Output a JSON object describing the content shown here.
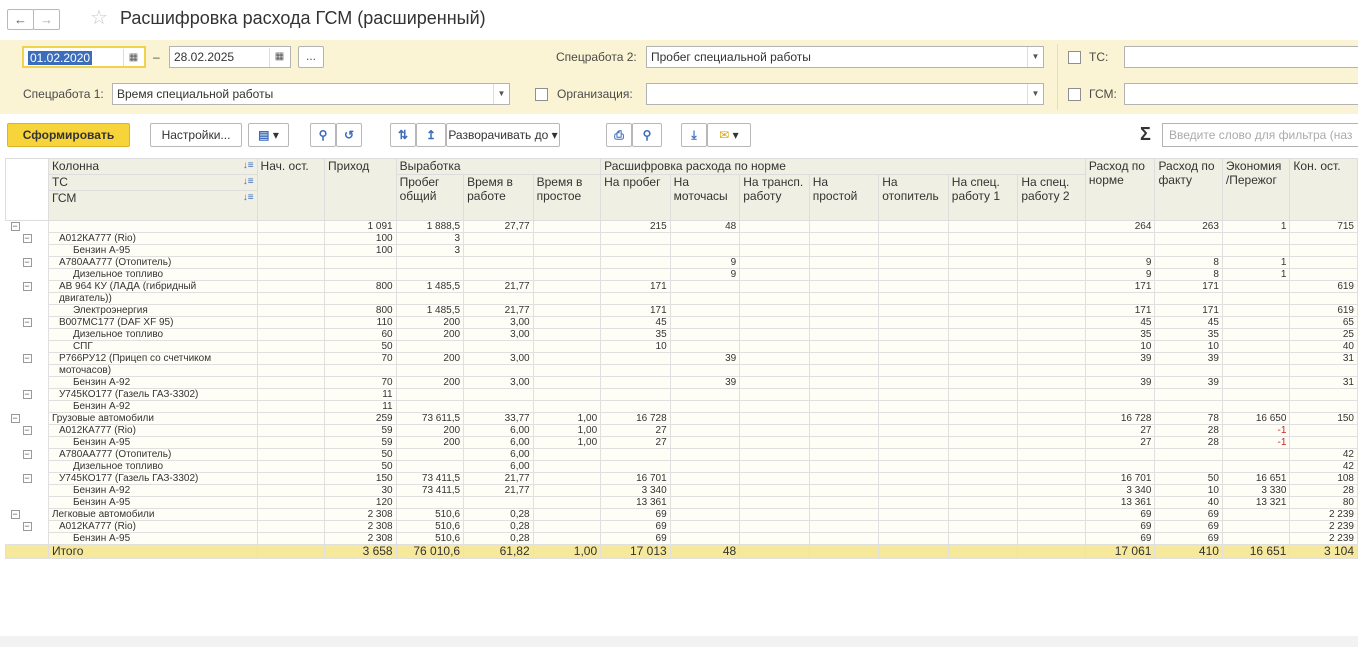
{
  "title": "Расшифровка расхода ГСМ (расширенный)",
  "filters": {
    "date_from": "01.02.2020",
    "date_separator": "–",
    "date_to": "28.02.2025",
    "ellipsis": "...",
    "spec2_label": "Спецработа 2:",
    "spec2_value": "Пробег специальной работы",
    "spec1_label": "Спецработа 1:",
    "spec1_value": "Время специальной работы",
    "org_label": "Организация:",
    "org_value": "",
    "tc_label": "ТС:",
    "gsm_label": "ГСМ:"
  },
  "toolbar": {
    "generate": "Сформировать",
    "settings": "Настройки...",
    "expand": "Разворачивать до",
    "search_placeholder": "Введите слово для фильтра (наз"
  },
  "table": {
    "headers": {
      "column": "Колонна",
      "tc": "ТС",
      "gsm": "ГСМ",
      "start": "Нач. ост.",
      "income": "Приход",
      "output": "Выработка",
      "mileage": "Пробег общий",
      "work_time": "Время в работе",
      "idle_time": "Время в простое",
      "decode": "Расшифровка расхода по норме",
      "n_mileage": "На пробег",
      "n_motohours": "На моточасы",
      "n_transp": "На трансп. работу",
      "n_idle": "На простой",
      "n_heater": "На отопитель",
      "n_spec1": "На спец. работу 1",
      "n_spec2": "На спец. работу 2",
      "norm": "Расход по норме",
      "fact": "Расход по факту",
      "econ": "Экономия /Пережог",
      "end": "Кон. ост."
    },
    "rows": [
      {
        "lvl": 0,
        "tog": "⊟",
        "tname": "",
        "name": "",
        "start": "",
        "income": "1 091",
        "mileage": "1 888,5",
        "work": "27,77",
        "idle": "",
        "nm": "215",
        "nmh": "48",
        "nt": "",
        "ni": "",
        "nh": "",
        "ns1": "",
        "ns2": "",
        "norm": "264",
        "fact": "263",
        "econ": "1",
        "end": "715"
      },
      {
        "lvl": 1,
        "tog": "⊟",
        "name": "А012КА777 (Rio)",
        "start": "",
        "income": "100",
        "mileage": "3",
        "work": "",
        "idle": "",
        "nm": "",
        "nmh": "",
        "nt": "",
        "ni": "",
        "nh": "",
        "ns1": "",
        "ns2": "",
        "norm": "",
        "fact": "",
        "econ": "",
        "end": ""
      },
      {
        "lvl": 2,
        "tog": "",
        "name": "Бензин А-95",
        "start": "",
        "income": "100",
        "mileage": "3",
        "work": "",
        "idle": "",
        "nm": "",
        "nmh": "",
        "nt": "",
        "ni": "",
        "nh": "",
        "ns1": "",
        "ns2": "",
        "norm": "",
        "fact": "",
        "econ": "",
        "end": ""
      },
      {
        "lvl": 1,
        "tog": "⊟",
        "name": "А780АА777 (Отопитель)",
        "start": "",
        "income": "",
        "mileage": "",
        "work": "",
        "idle": "",
        "nm": "",
        "nmh": "9",
        "nt": "",
        "ni": "",
        "nh": "",
        "ns1": "",
        "ns2": "",
        "norm": "9",
        "fact": "8",
        "econ": "1",
        "end": ""
      },
      {
        "lvl": 2,
        "tog": "",
        "name": "Дизельное топливо",
        "start": "",
        "income": "",
        "mileage": "",
        "work": "",
        "idle": "",
        "nm": "",
        "nmh": "9",
        "nt": "",
        "ni": "",
        "nh": "",
        "ns1": "",
        "ns2": "",
        "norm": "9",
        "fact": "8",
        "econ": "1",
        "end": ""
      },
      {
        "lvl": 1,
        "tog": "⊟",
        "name": "АВ 964 КУ (ЛАДА (гибридный",
        "name2": "двигатель))",
        "start": "",
        "income": "800",
        "mileage": "1 485,5",
        "work": "21,77",
        "idle": "",
        "nm": "171",
        "nmh": "",
        "nt": "",
        "ni": "",
        "nh": "",
        "ns1": "",
        "ns2": "",
        "norm": "171",
        "fact": "171",
        "econ": "",
        "end": "619"
      },
      {
        "lvl": 2,
        "tog": "",
        "name": "Электроэнергия",
        "start": "",
        "income": "800",
        "mileage": "1 485,5",
        "work": "21,77",
        "idle": "",
        "nm": "171",
        "nmh": "",
        "nt": "",
        "ni": "",
        "nh": "",
        "ns1": "",
        "ns2": "",
        "norm": "171",
        "fact": "171",
        "econ": "",
        "end": "619"
      },
      {
        "lvl": 1,
        "tog": "⊟",
        "name": "В007МС177 (DAF XF 95)",
        "start": "",
        "income": "110",
        "mileage": "200",
        "work": "3,00",
        "idle": "",
        "nm": "45",
        "nmh": "",
        "nt": "",
        "ni": "",
        "nh": "",
        "ns1": "",
        "ns2": "",
        "norm": "45",
        "fact": "45",
        "econ": "",
        "end": "65"
      },
      {
        "lvl": 2,
        "tog": "",
        "name": "Дизельное топливо",
        "start": "",
        "income": "60",
        "mileage": "200",
        "work": "3,00",
        "idle": "",
        "nm": "35",
        "nmh": "",
        "nt": "",
        "ni": "",
        "nh": "",
        "ns1": "",
        "ns2": "",
        "norm": "35",
        "fact": "35",
        "econ": "",
        "end": "25"
      },
      {
        "lvl": 2,
        "tog": "",
        "name": "СПГ",
        "start": "",
        "income": "50",
        "mileage": "",
        "work": "",
        "idle": "",
        "nm": "10",
        "nmh": "",
        "nt": "",
        "ni": "",
        "nh": "",
        "ns1": "",
        "ns2": "",
        "norm": "10",
        "fact": "10",
        "econ": "",
        "end": "40"
      },
      {
        "lvl": 1,
        "tog": "⊟",
        "name": "Р766РУ12 (Прицеп со счетчиком",
        "name2": "моточасов)",
        "start": "",
        "income": "70",
        "mileage": "200",
        "work": "3,00",
        "idle": "",
        "nm": "",
        "nmh": "39",
        "nt": "",
        "ni": "",
        "nh": "",
        "ns1": "",
        "ns2": "",
        "norm": "39",
        "fact": "39",
        "econ": "",
        "end": "31"
      },
      {
        "lvl": 2,
        "tog": "",
        "name": "Бензин А-92",
        "start": "",
        "income": "70",
        "mileage": "200",
        "work": "3,00",
        "idle": "",
        "nm": "",
        "nmh": "39",
        "nt": "",
        "ni": "",
        "nh": "",
        "ns1": "",
        "ns2": "",
        "norm": "39",
        "fact": "39",
        "econ": "",
        "end": "31"
      },
      {
        "lvl": 1,
        "tog": "⊟",
        "name": "У745КО177 (Газель ГАЗ-3302)",
        "start": "",
        "income": "11",
        "mileage": "",
        "work": "",
        "idle": "",
        "nm": "",
        "nmh": "",
        "nt": "",
        "ni": "",
        "nh": "",
        "ns1": "",
        "ns2": "",
        "norm": "",
        "fact": "",
        "econ": "",
        "end": ""
      },
      {
        "lvl": 2,
        "tog": "",
        "name": "Бензин А-92",
        "start": "",
        "income": "11",
        "mileage": "",
        "work": "",
        "idle": "",
        "nm": "",
        "nmh": "",
        "nt": "",
        "ni": "",
        "nh": "",
        "ns1": "",
        "ns2": "",
        "norm": "",
        "fact": "",
        "econ": "",
        "end": ""
      },
      {
        "lvl": 0,
        "tog": "⊟",
        "name": "Грузовые автомобили",
        "start": "",
        "income": "259",
        "mileage": "73 611,5",
        "work": "33,77",
        "idle": "1,00",
        "nm": "16 728",
        "nmh": "",
        "nt": "",
        "ni": "",
        "nh": "",
        "ns1": "",
        "ns2": "",
        "norm": "16 728",
        "fact": "78",
        "econ": "16 650",
        "end": "150"
      },
      {
        "lvl": 1,
        "tog": "⊟",
        "name": "А012КА777 (Rio)",
        "start": "",
        "income": "59",
        "mileage": "200",
        "work": "6,00",
        "idle": "1,00",
        "nm": "27",
        "nmh": "",
        "nt": "",
        "ni": "",
        "nh": "",
        "ns1": "",
        "ns2": "",
        "norm": "27",
        "fact": "28",
        "econ": "-1",
        "end": ""
      },
      {
        "lvl": 2,
        "tog": "",
        "name": "Бензин А-95",
        "start": "",
        "income": "59",
        "mileage": "200",
        "work": "6,00",
        "idle": "1,00",
        "nm": "27",
        "nmh": "",
        "nt": "",
        "ni": "",
        "nh": "",
        "ns1": "",
        "ns2": "",
        "norm": "27",
        "fact": "28",
        "econ": "-1",
        "end": ""
      },
      {
        "lvl": 1,
        "tog": "⊟",
        "name": "А780АА777 (Отопитель)",
        "start": "",
        "income": "50",
        "mileage": "",
        "work": "6,00",
        "idle": "",
        "nm": "",
        "nmh": "",
        "nt": "",
        "ni": "",
        "nh": "",
        "ns1": "",
        "ns2": "",
        "norm": "",
        "fact": "",
        "econ": "",
        "end": "42"
      },
      {
        "lvl": 2,
        "tog": "",
        "name": "Дизельное топливо",
        "start": "",
        "income": "50",
        "mileage": "",
        "work": "6,00",
        "idle": "",
        "nm": "",
        "nmh": "",
        "nt": "",
        "ni": "",
        "nh": "",
        "ns1": "",
        "ns2": "",
        "norm": "",
        "fact": "",
        "econ": "",
        "end": "42"
      },
      {
        "lvl": 1,
        "tog": "⊟",
        "name": "У745КО177 (Газель ГАЗ-3302)",
        "start": "",
        "income": "150",
        "mileage": "73 411,5",
        "work": "21,77",
        "idle": "",
        "nm": "16 701",
        "nmh": "",
        "nt": "",
        "ni": "",
        "nh": "",
        "ns1": "",
        "ns2": "",
        "norm": "16 701",
        "fact": "50",
        "econ": "16 651",
        "end": "108"
      },
      {
        "lvl": 2,
        "tog": "",
        "name": "Бензин А-92",
        "start": "",
        "income": "30",
        "mileage": "73 411,5",
        "work": "21,77",
        "idle": "",
        "nm": "3 340",
        "nmh": "",
        "nt": "",
        "ni": "",
        "nh": "",
        "ns1": "",
        "ns2": "",
        "norm": "3 340",
        "fact": "10",
        "econ": "3 330",
        "end": "28"
      },
      {
        "lvl": 2,
        "tog": "",
        "name": "Бензин А-95",
        "start": "",
        "income": "120",
        "mileage": "",
        "work": "",
        "idle": "",
        "nm": "13 361",
        "nmh": "",
        "nt": "",
        "ni": "",
        "nh": "",
        "ns1": "",
        "ns2": "",
        "norm": "13 361",
        "fact": "40",
        "econ": "13 321",
        "end": "80"
      },
      {
        "lvl": 0,
        "tog": "⊟",
        "name": "Легковые автомобили",
        "start": "",
        "income": "2 308",
        "mileage": "510,6",
        "work": "0,28",
        "idle": "",
        "nm": "69",
        "nmh": "",
        "nt": "",
        "ni": "",
        "nh": "",
        "ns1": "",
        "ns2": "",
        "norm": "69",
        "fact": "69",
        "econ": "",
        "end": "2 239"
      },
      {
        "lvl": 1,
        "tog": "⊟",
        "name": "А012КА777 (Rio)",
        "start": "",
        "income": "2 308",
        "mileage": "510,6",
        "work": "0,28",
        "idle": "",
        "nm": "69",
        "nmh": "",
        "nt": "",
        "ni": "",
        "nh": "",
        "ns1": "",
        "ns2": "",
        "norm": "69",
        "fact": "69",
        "econ": "",
        "end": "2 239"
      },
      {
        "lvl": 2,
        "tog": "",
        "name": "Бензин А-95",
        "start": "",
        "income": "2 308",
        "mileage": "510,6",
        "work": "0,28",
        "idle": "",
        "nm": "69",
        "nmh": "",
        "nt": "",
        "ni": "",
        "nh": "",
        "ns1": "",
        "ns2": "",
        "norm": "69",
        "fact": "69",
        "econ": "",
        "end": "2 239"
      }
    ],
    "total": {
      "name": "Итого",
      "start": "",
      "income": "3 658",
      "mileage": "76 010,6",
      "work": "61,82",
      "idle": "1,00",
      "nm": "17 013",
      "nmh": "48",
      "nt": "",
      "ni": "",
      "nh": "",
      "ns1": "",
      "ns2": "",
      "norm": "17 061",
      "fact": "410",
      "econ": "16 651",
      "end": "3 104"
    }
  }
}
